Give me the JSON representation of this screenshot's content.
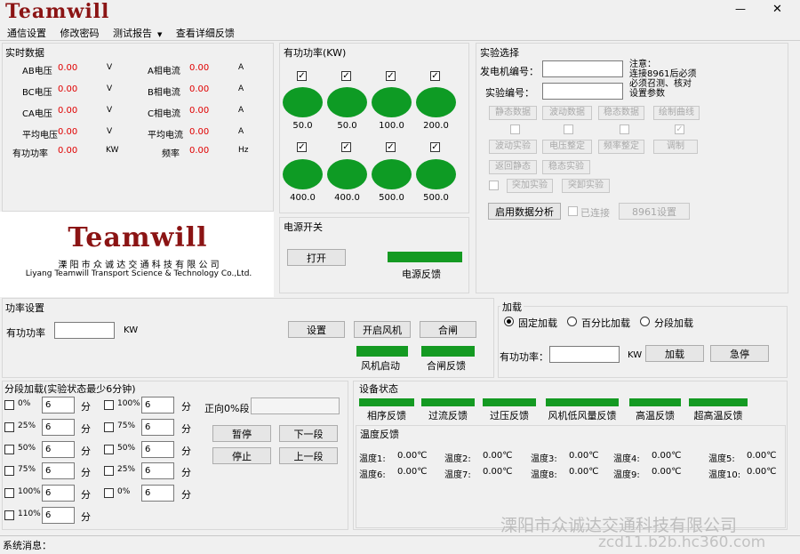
{
  "app": {
    "logo": "Teamwill",
    "window_controls": {
      "minimize": "—",
      "close": "✕"
    },
    "menu": [
      "通信设置",
      "修改密码",
      "测试报告",
      "查看详细反馈"
    ],
    "menu_arrow": "▼"
  },
  "realtime": {
    "title": "实时数据",
    "rows": [
      {
        "left_label": "AB电压",
        "left_value": "0.00",
        "left_unit": "V",
        "right_label": "A相电流",
        "right_value": "0.00",
        "right_unit": "A"
      },
      {
        "left_label": "BC电压",
        "left_value": "0.00",
        "left_unit": "V",
        "right_label": "B相电流",
        "right_value": "0.00",
        "right_unit": "A"
      },
      {
        "left_label": "CA电压",
        "left_value": "0.00",
        "left_unit": "V",
        "right_label": "C相电流",
        "right_value": "0.00",
        "right_unit": "A"
      },
      {
        "left_label": "平均电压",
        "left_value": "0.00",
        "left_unit": "V",
        "right_label": "平均电流",
        "right_value": "0.00",
        "right_unit": "A"
      },
      {
        "left_label": "有功功率",
        "left_value": "0.00",
        "left_unit": "KW",
        "right_label": "频率",
        "right_value": "0.00",
        "right_unit": "Hz"
      }
    ]
  },
  "company": {
    "logo": "Teamwill",
    "name_cn": "溧 阳 市 众 诚 达 交 通 科 技 有 限 公 司",
    "name_en": "Liyang Teamwill Transport Science & Technology Co.,Ltd."
  },
  "active_power": {
    "title": "有功功率(KW)",
    "units": [
      {
        "checked": true,
        "value": "50.0"
      },
      {
        "checked": true,
        "value": "50.0"
      },
      {
        "checked": true,
        "value": "100.0"
      },
      {
        "checked": true,
        "value": "200.0"
      },
      {
        "checked": true,
        "value": "400.0"
      },
      {
        "checked": true,
        "value": "400.0"
      },
      {
        "checked": true,
        "value": "500.0"
      },
      {
        "checked": true,
        "value": "500.0"
      }
    ],
    "check_mark": "✓"
  },
  "power_switch": {
    "title": "电源开关",
    "open_label": "打开",
    "feedback_label": "电源反馈"
  },
  "experiment": {
    "title": "实验选择",
    "generator_label": "发电机编号：",
    "experiment_no_label": "实验编号：",
    "notice": [
      "注意：",
      "连接8961后必须",
      "必须召测、核对",
      "设置参数"
    ],
    "buttons_row1": [
      "静态数据",
      "波动数据",
      "稳态数据",
      "绘制曲线"
    ],
    "buttons_row2": [
      "波动实验",
      "电压整定",
      "频率整定",
      "调制"
    ],
    "buttons_row3": [
      "返回静态",
      "稳态实验"
    ],
    "buttons_row4": [
      "突加实验",
      "突卸实验"
    ],
    "analysis_label": "启用数据分析",
    "connected_label": "已连接",
    "settings_label": "8961设置"
  },
  "power_setting": {
    "title": "功率设置",
    "active_label": "有功功率",
    "unit": "KW",
    "set_label": "设置",
    "fan_on_label": "开启风机",
    "close_label": "合闸",
    "fan_start_label": "风机启动",
    "close_feedback_label": "合闸反馈"
  },
  "loading": {
    "title": "加载",
    "options": [
      "固定加载",
      "百分比加载",
      "分段加载"
    ],
    "selected": 0,
    "active_label": "有功功率：",
    "unit": "KW",
    "load_label": "加载",
    "stop_label": "急停"
  },
  "segment": {
    "title": "分段加载(实验状态最少6分钟)",
    "left": [
      {
        "label": "0%",
        "value": "6",
        "unit": "分"
      },
      {
        "label": "25%",
        "value": "6",
        "unit": "分"
      },
      {
        "label": "50%",
        "value": "6",
        "unit": "分"
      },
      {
        "label": "75%",
        "value": "6",
        "unit": "分"
      },
      {
        "label": "100%",
        "value": "6",
        "unit": "分"
      },
      {
        "label": "110%",
        "value": "6",
        "unit": "分"
      }
    ],
    "right": [
      {
        "label": "100%",
        "value": "6",
        "unit": "分"
      },
      {
        "label": "75%",
        "value": "6",
        "unit": "分"
      },
      {
        "label": "50%",
        "value": "6",
        "unit": "分"
      },
      {
        "label": "25%",
        "value": "6",
        "unit": "分"
      },
      {
        "label": "0%",
        "value": "6",
        "unit": "分"
      }
    ],
    "status_label": "正向0%段",
    "pause_label": "暂停",
    "next_label": "下一段",
    "stop_label": "停止",
    "prev_label": "上一段"
  },
  "device_status": {
    "title": "设备状态",
    "indicators": [
      "相序反馈",
      "过流反馈",
      "过压反馈",
      "风机低风量反馈",
      "高温反馈",
      "超高温反馈"
    ]
  },
  "temperature": {
    "title": "温度反馈",
    "row1": [
      {
        "label": "温度1:",
        "value": "0.00℃"
      },
      {
        "label": "温度2:",
        "value": "0.00℃"
      },
      {
        "label": "温度3:",
        "value": "0.00℃"
      },
      {
        "label": "温度4:",
        "value": "0.00℃"
      },
      {
        "label": "温度5:",
        "value": "0.00℃"
      }
    ],
    "row2": [
      {
        "label": "温度6:",
        "value": "0.00℃"
      },
      {
        "label": "温度7:",
        "value": "0.00℃"
      },
      {
        "label": "温度8:",
        "value": "0.00℃"
      },
      {
        "label": "温度9:",
        "value": "0.00℃"
      },
      {
        "label": "温度10:",
        "value": "0.00℃"
      }
    ]
  },
  "statusbar": {
    "label": "系统消息："
  },
  "watermark": {
    "company": "溧阳市众诚达交通科技有限公司",
    "url": "zcd11.b2b.hc360.com"
  }
}
